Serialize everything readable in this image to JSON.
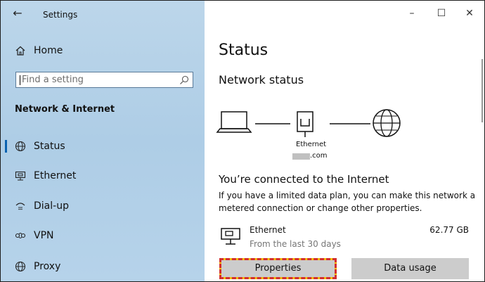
{
  "window": {
    "title": "Settings",
    "back_icon": "back-arrow-icon"
  },
  "sidebar": {
    "home_label": "Home",
    "search_placeholder": "Find a setting",
    "section_title": "Network & Internet",
    "items": [
      {
        "label": "Status",
        "icon": "globe-icon",
        "active": true
      },
      {
        "label": "Ethernet",
        "icon": "ethernet-icon",
        "active": false
      },
      {
        "label": "Dial-up",
        "icon": "dialup-icon",
        "active": false
      },
      {
        "label": "VPN",
        "icon": "vpn-icon",
        "active": false
      },
      {
        "label": "Proxy",
        "icon": "globe-icon",
        "active": false
      }
    ]
  },
  "controls": {
    "minimize": "–",
    "maximize": "☐",
    "close": "✕"
  },
  "main": {
    "title": "Status",
    "network_status": "Network status",
    "diagram": {
      "adapter_label": "Ethernet",
      "domain_suffix": ".com"
    },
    "connected_heading": "You’re connected to the Internet",
    "description": "If you have a limited data plan, you can make this network a metered connection or change other properties.",
    "usage": {
      "name": "Ethernet",
      "period": "From the last 30 days",
      "amount": "62.77 GB"
    },
    "buttons": {
      "properties": "Properties",
      "data_usage": "Data usage"
    }
  },
  "colors": {
    "sidebar_bg": "#b6d3ea",
    "accent": "#0a62b0",
    "button_bg": "#cccccc",
    "highlight_outline": "#d32f2f",
    "highlight_inner": "#f2c200"
  }
}
